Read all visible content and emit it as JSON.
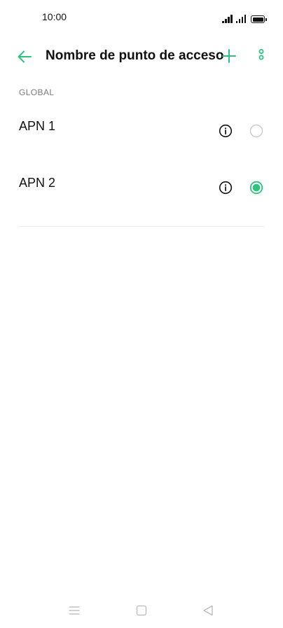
{
  "status_bar": {
    "time": "10:00"
  },
  "app_bar": {
    "title": "Nombre de punto de acceso"
  },
  "section": {
    "header": "GLOBAL"
  },
  "apns": [
    {
      "name": "APN 1",
      "selected": false
    },
    {
      "name": "APN 2",
      "selected": true
    }
  ],
  "colors": {
    "accent": "#2fc27f",
    "text": "#111111",
    "section_header": "#7a7a7a",
    "radio_off": "#c8c8c8",
    "divider": "#ececec",
    "nav": "#b8b8b8"
  },
  "icons": {
    "back": "arrow-left-icon",
    "add": "plus-icon",
    "more": "more-vertical-icon",
    "info": "info-icon",
    "nav_menu": "menu-lines-icon",
    "nav_home": "square-icon",
    "nav_back": "triangle-back-icon"
  }
}
